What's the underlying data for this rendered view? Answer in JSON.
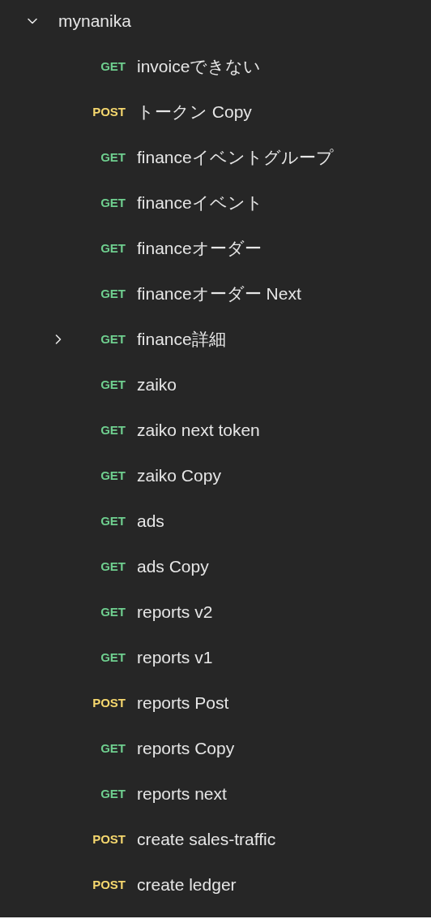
{
  "folder": {
    "name": "mynanika",
    "expanded": true
  },
  "requests": [
    {
      "method": "GET",
      "name": "invoiceできない",
      "expandable": false
    },
    {
      "method": "POST",
      "name": "トークン Copy",
      "expandable": false
    },
    {
      "method": "GET",
      "name": "financeイベントグループ",
      "expandable": false
    },
    {
      "method": "GET",
      "name": "financeイベント",
      "expandable": false
    },
    {
      "method": "GET",
      "name": "financeオーダー",
      "expandable": false
    },
    {
      "method": "GET",
      "name": "financeオーダー Next",
      "expandable": false
    },
    {
      "method": "GET",
      "name": "finance詳細",
      "expandable": true
    },
    {
      "method": "GET",
      "name": "zaiko",
      "expandable": false
    },
    {
      "method": "GET",
      "name": "zaiko next token",
      "expandable": false
    },
    {
      "method": "GET",
      "name": "zaiko Copy",
      "expandable": false
    },
    {
      "method": "GET",
      "name": "ads",
      "expandable": false
    },
    {
      "method": "GET",
      "name": "ads Copy",
      "expandable": false
    },
    {
      "method": "GET",
      "name": "reports v2",
      "expandable": false
    },
    {
      "method": "GET",
      "name": "reports v1",
      "expandable": false
    },
    {
      "method": "POST",
      "name": "reports Post",
      "expandable": false
    },
    {
      "method": "GET",
      "name": "reports Copy",
      "expandable": false
    },
    {
      "method": "GET",
      "name": "reports next",
      "expandable": false
    },
    {
      "method": "POST",
      "name": "create sales-traffic",
      "expandable": false
    },
    {
      "method": "POST",
      "name": "create ledger",
      "expandable": false
    }
  ]
}
